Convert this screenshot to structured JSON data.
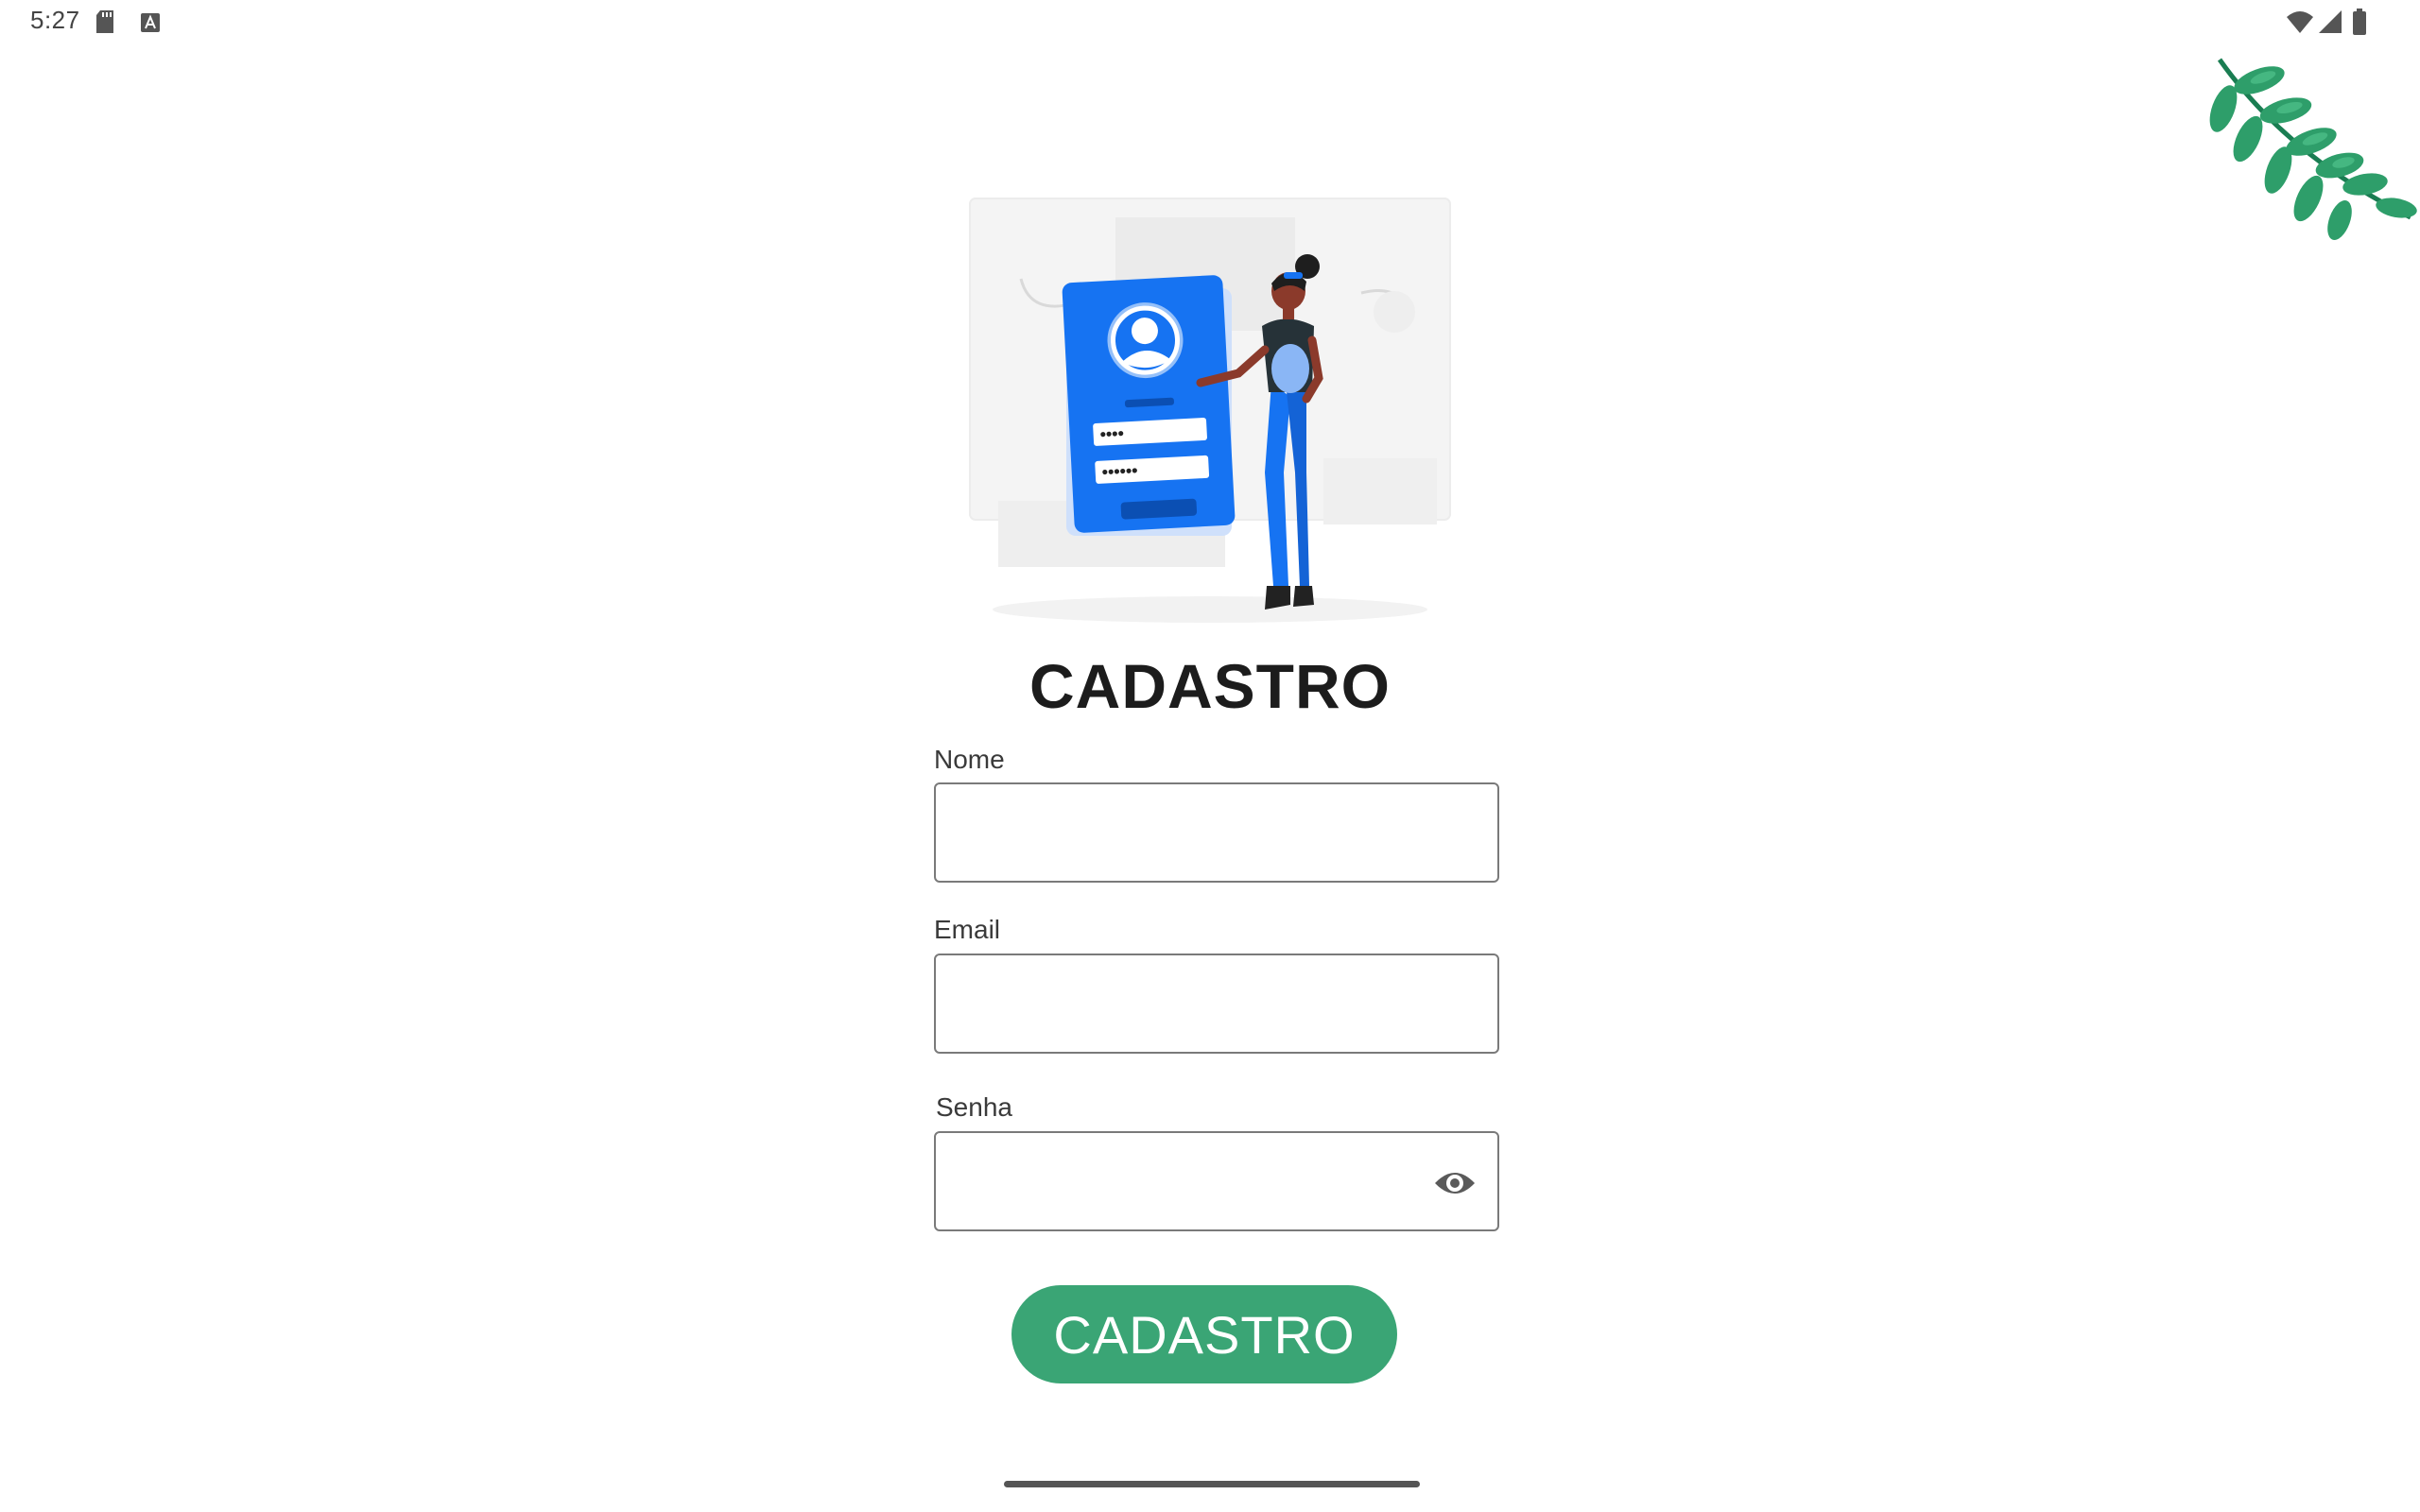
{
  "status_bar": {
    "time": "5:27",
    "left_icons": [
      "sd-card-icon",
      "keyboard-a-icon"
    ],
    "right_icons": [
      "wifi-icon",
      "cellular-signal-icon",
      "battery-icon"
    ]
  },
  "illustration": {
    "name": "signup-illustration",
    "password_dots_short": "••••",
    "password_dots_long": "••••••"
  },
  "title": "CADASTRO",
  "form": {
    "name_label": "Nome",
    "name_value": "",
    "email_label": "Email",
    "email_value": "",
    "password_label": "Senha",
    "password_value": "",
    "password_toggle_icon": "eye-icon"
  },
  "submit_label": "CADASTRO",
  "colors": {
    "primary_green": "#3aa575",
    "leaf_green": "#2e9e6a",
    "illustration_blue": "#1673f2",
    "text_dark": "#1c1c1c"
  }
}
